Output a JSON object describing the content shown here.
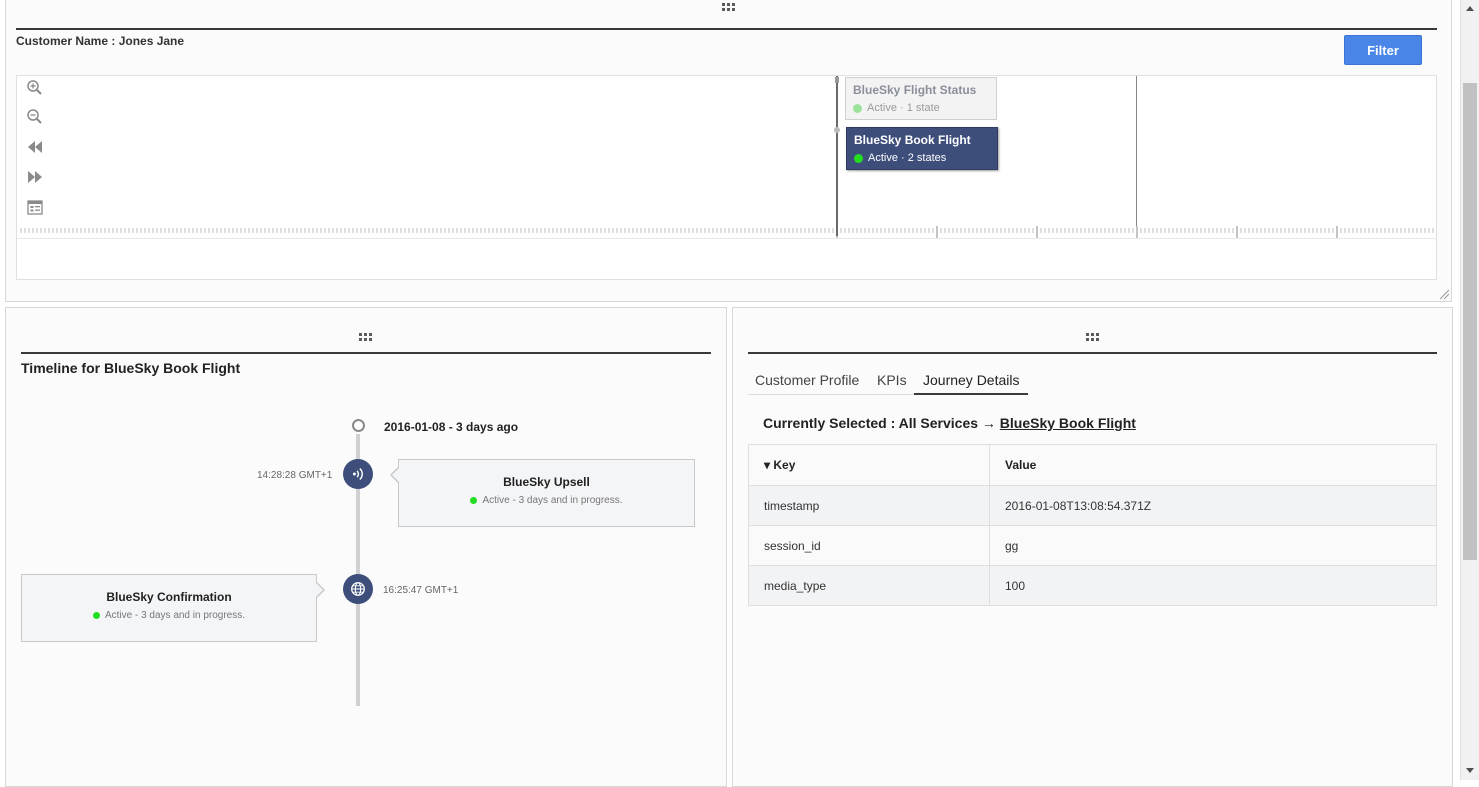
{
  "top_panel": {
    "customer_name": "Customer Name : Jones Jane",
    "filter_label": "Filter",
    "tools": [
      "zoom-in-icon",
      "zoom-out-icon",
      "rewind-icon",
      "fast-forward-icon",
      "calendar-icon"
    ],
    "cards": [
      {
        "title": "BlueSky Flight Status",
        "subtitle": "Active · 1 state",
        "status_color": "#9be39b"
      },
      {
        "title": "BlueSky Book Flight",
        "subtitle": "Active · 2 states",
        "status_color": "#22dd22"
      }
    ]
  },
  "timeline": {
    "title": "Timeline for BlueSky Book Flight",
    "date_label": "2016-01-08 - 3 days ago",
    "events": [
      {
        "time": "14:28:28 GMT+1",
        "icon": "signal-icon",
        "title": "BlueSky Upsell",
        "status": "Active - 3 days and in progress."
      },
      {
        "time": "16:25:47 GMT+1",
        "icon": "globe-icon",
        "title": "BlueSky Confirmation",
        "status": "Active - 3 days and in progress."
      }
    ]
  },
  "details": {
    "tabs": [
      "Customer Profile",
      "KPIs",
      "Journey Details"
    ],
    "active_tab": "Journey Details",
    "selected_prefix": "Currently Selected : All Services → ",
    "selected_link": "BlueSky Book Flight",
    "table": {
      "headers": [
        "▾ Key",
        "Value"
      ],
      "rows": [
        [
          "timestamp",
          "2016-01-08T13:08:54.371Z"
        ],
        [
          "session_id",
          "gg"
        ],
        [
          "media_type",
          "100"
        ]
      ]
    }
  },
  "colors": {
    "accent": "#4a86e8",
    "navy": "#3d4e7a",
    "active_green": "#22dd22"
  }
}
